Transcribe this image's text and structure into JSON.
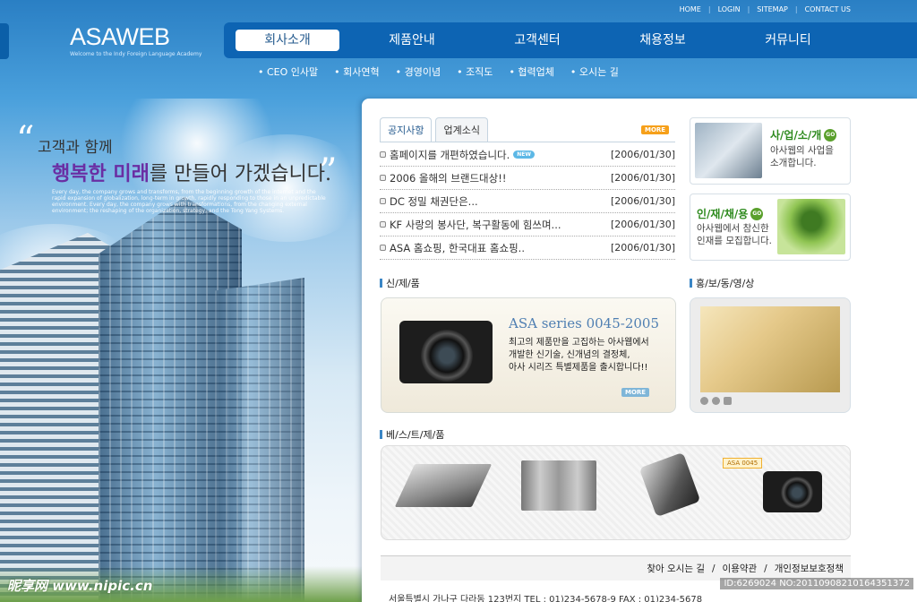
{
  "logo": {
    "text": "ASAWEB",
    "subtitle": "Welcome to the Indy Foreign Language Academy"
  },
  "utility_links": [
    "HOME",
    "LOGIN",
    "SITEMAP",
    "CONTACT US"
  ],
  "nav": [
    "회사소개",
    "제품안내",
    "고객센터",
    "채용정보",
    "커뮤니티"
  ],
  "subnav": [
    "• CEO 인사말",
    "• 회사연혁",
    "• 경영이념",
    "• 조직도",
    "• 협력업체",
    "• 오시는 길"
  ],
  "slogan": {
    "line1": "고객과 함께",
    "line2_highlight": "행복한 미래",
    "line2_rest": "를 만들어 가겠습니다.",
    "english": "Every day, the company grows and transforms, from the beginning growth of the internet and the rapid expansion of globalization, long-term in growth, rapidly responding to those in an unpredictable environment. Every day, the company grows with transformations, from the changing external environment; the reshaping of the organization, strategy, and the Tong Yang Systems."
  },
  "notice": {
    "tabs": [
      "공지사항",
      "업계소식"
    ],
    "more": "MORE",
    "new_badge": "NEW",
    "items": [
      {
        "title": "홈페이지를 개편하였습니다.",
        "date": "[2006/01/30]"
      },
      {
        "title": "2006 올해의 브랜드대상!!",
        "date": "[2006/01/30]"
      },
      {
        "title": "DC 정밀 채권단은...",
        "date": "[2006/01/30]"
      },
      {
        "title": "KF 사랑의 봉사단, 복구활동에 힘쓰며...",
        "date": "[2006/01/30]"
      },
      {
        "title": "ASA 홈쇼핑, 한국대표 홈쇼핑..",
        "date": "[2006/01/30]"
      }
    ]
  },
  "biz": {
    "title": "사/업/소/개",
    "go": "GO",
    "desc1": "아사웹의 사업을",
    "desc2": "소개합니다."
  },
  "recruit": {
    "title": "인/재/채/용",
    "go": "GO",
    "desc1": "아사웹에서 참신한",
    "desc2": "인재를 모집합니다."
  },
  "new_product": {
    "section": "신/제/품",
    "title": "ASA series 0045-2005",
    "desc1": "최고의 제품만을 고집하는 아사웹에서",
    "desc2": "개발한 신기술, 신개념의 결정체,",
    "desc3": "아사 시리즈 특별제품을 출시합니다!!",
    "more": "MORE"
  },
  "promo_video": {
    "section": "홍/보/동/영/상"
  },
  "best": {
    "section": "베/스/트/제/품",
    "tag": "ASA 0045"
  },
  "footer": {
    "links": [
      "찾아 오시는 길",
      "/",
      "이용약관",
      "/",
      "개인정보보호정책"
    ],
    "address": "서울특별시 가나구 다라동 123번지    TEL : 01)234-5678-9    FAX : 01)234-5678"
  },
  "watermark": {
    "left": "昵享网 www.nipic.cn",
    "right": "ID:6269024 NO:20110908210164351372"
  }
}
